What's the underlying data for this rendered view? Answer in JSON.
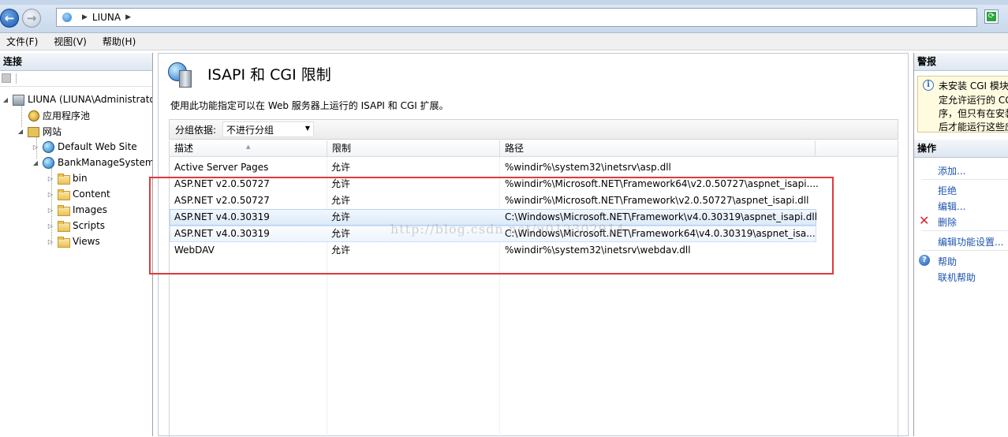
{
  "address": {
    "path": "LIUNA"
  },
  "menu": [
    "文件(F)",
    "视图(V)",
    "帮助(H)"
  ],
  "left_panel": {
    "header": "连接",
    "tree": [
      {
        "label": "LIUNA (LIUNA\\Administrator",
        "icon": "server-icon",
        "expanded": true
      },
      {
        "label": "应用程序池",
        "icon": "app-pool-icon"
      },
      {
        "label": "网站",
        "icon": "sites-icon",
        "expanded": true
      },
      {
        "label": "Default Web Site",
        "icon": "globe-icon",
        "expanded": false
      },
      {
        "label": "BankManageSystem",
        "icon": "globe-icon",
        "expanded": true
      },
      {
        "label": "bin",
        "icon": "folder-icon"
      },
      {
        "label": "Content",
        "icon": "folder-icon"
      },
      {
        "label": "Images",
        "icon": "folder-icon"
      },
      {
        "label": "Scripts",
        "icon": "folder-icon"
      },
      {
        "label": "Views",
        "icon": "folder-icon"
      }
    ]
  },
  "main": {
    "title": "ISAPI 和 CGI 限制",
    "description": "使用此功能指定可以在 Web 服务器上运行的 ISAPI 和 CGI 扩展。",
    "group_label": "分组依据:",
    "group_value": "不进行分组",
    "columns": [
      "描述",
      "限制",
      "路径"
    ],
    "rows": [
      {
        "desc": "Active Server Pages",
        "limit": "允许",
        "path": "%windir%\\system32\\inetsrv\\asp.dll"
      },
      {
        "desc": "ASP.NET v2.0.50727",
        "limit": "允许",
        "path": "%windir%\\Microsoft.NET\\Framework64\\v2.0.50727\\aspnet_isapi...."
      },
      {
        "desc": "ASP.NET v2.0.50727",
        "limit": "允许",
        "path": "%windir%\\Microsoft.NET\\Framework\\v2.0.50727\\aspnet_isapi.dll"
      },
      {
        "desc": "ASP.NET v4.0.30319",
        "limit": "允许",
        "path": "C:\\Windows\\Microsoft.NET\\Framework\\v4.0.30319\\aspnet_isapi.dll"
      },
      {
        "desc": "ASP.NET v4.0.30319",
        "limit": "允许",
        "path": "C:\\Windows\\Microsoft.NET\\Framework64\\v4.0.30319\\aspnet_isa..."
      },
      {
        "desc": "WebDAV",
        "limit": "允许",
        "path": "%windir%\\system32\\inetsrv\\webdav.dll"
      }
    ],
    "watermark": "http://blog.csdn.net/u012302914"
  },
  "right_panel": {
    "alerts_header": "警报",
    "alert_lines": [
      "未安装 CGI 模块",
      "定允许运行的 CG",
      "序，但只有在安装",
      "后才能运行这些应"
    ],
    "actions_header": "操作",
    "actions": {
      "add": "添加...",
      "deny": "拒绝",
      "edit": "编辑...",
      "delete": "删除",
      "edit_settings": "编辑功能设置...",
      "help": "帮助",
      "online_help": "联机帮助"
    }
  }
}
